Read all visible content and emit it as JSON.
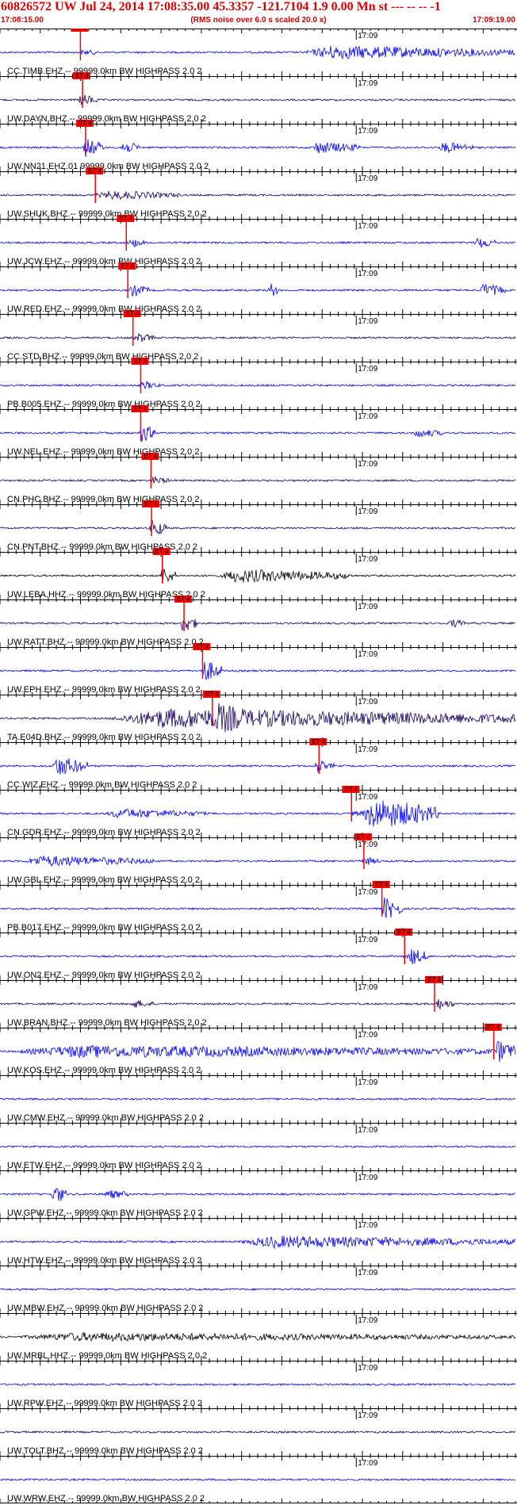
{
  "header": {
    "title": "60826572 UW Jul 24, 2014 17:08:35.00   45.3357 -121.7104  1.9 0.00 Mn st --- -- --   -1",
    "start_time": "17:08:15.00",
    "note": "(RMS noise over 6.0 s scaled 20.0 x)",
    "end_time": "17:09:19.00"
  },
  "colors": {
    "header_text": "#e00000",
    "pick": "#ff0000",
    "trace_blue": "#0000ff",
    "trace_navy": "#1a0060",
    "trace_black": "#000000"
  },
  "chart_data": {
    "type": "line",
    "title": "60826572 UW Jul 24, 2014 17:08:35.00   45.3357 -121.7104  1.9 0.00 Mn st --- -- --   -1",
    "x_range": [
      "17:08:15.00",
      "17:09:19.00"
    ],
    "mid_time_label": "17:09",
    "pick_label": "ET 4",
    "series": [
      {
        "label": "CC.TIMB.EHZ.--  99999.0km BW  HIGHPASS  2.0  2",
        "color": "#0000ff",
        "pick": 0.156,
        "bursts": [
          [
            0.58,
            1.0,
            2.2
          ]
        ]
      },
      {
        "label": "UW.DAYN.BHZ.--  99999.0km BW  HIGHPASS  2.0  2",
        "color": "#1a0060",
        "pick": 0.16,
        "bursts": [
          [
            0.15,
            0.19,
            2.0
          ]
        ]
      },
      {
        "label": "UW.NN21.EHZ.01  99999.0km BW  HIGHPASS  2.0  2",
        "color": "#0000ff",
        "pick": 0.166,
        "bursts": [
          [
            0.16,
            0.2,
            3.0
          ],
          [
            0.23,
            0.27,
            2.2
          ],
          [
            0.6,
            0.7,
            2.0
          ],
          [
            0.85,
            0.92,
            1.8
          ]
        ]
      },
      {
        "label": "UW.SHUK.BHZ.--  99999.0km BW  HIGHPASS  2.0  2",
        "color": "#1a0060",
        "pick": 0.185,
        "bursts": [
          [
            0.19,
            0.35,
            1.5
          ]
        ]
      },
      {
        "label": "UW.JCW.EHZ.--  99999.0km BW  HIGHPASS  2.0  2",
        "color": "#0000ff",
        "pick": 0.245,
        "bursts": [
          [
            0.25,
            0.28,
            1.6
          ],
          [
            0.92,
            0.96,
            2.0
          ]
        ]
      },
      {
        "label": "UW.RED.EHZ.--  99999.0km BW  HIGHPASS  2.0  2",
        "color": "#0000ff",
        "pick": 0.248,
        "bursts": [
          [
            0.25,
            0.29,
            2.0
          ],
          [
            0.52,
            0.54,
            2.6
          ],
          [
            0.93,
            0.98,
            2.2
          ]
        ]
      },
      {
        "label": "CC.STD.BHZ.--  99999.0km BW  HIGHPASS  2.0  2",
        "color": "#1a0060",
        "pick": 0.258,
        "bursts": [
          [
            0.26,
            0.3,
            1.6
          ]
        ]
      },
      {
        "label": "PB.B005.EHZ.--  99999.0km BW  HIGHPASS  2.0  2",
        "color": "#0000ff",
        "pick": 0.273,
        "bursts": [
          [
            0.27,
            0.31,
            1.4
          ]
        ]
      },
      {
        "label": "UW.NEL.EHZ.--  99999.0km BW  HIGHPASS  2.0  2",
        "color": "#0000ff",
        "pick": 0.273,
        "bursts": [
          [
            0.27,
            0.3,
            3.0
          ],
          [
            0.8,
            0.86,
            1.5
          ]
        ]
      },
      {
        "label": "CN.PHC.BHZ.--  99999.0km BW  HIGHPASS  2.0  2",
        "color": "#1a0060",
        "pick": 0.293,
        "bursts": [
          [
            0.29,
            0.33,
            1.4
          ]
        ]
      },
      {
        "label": "CN.PNT.BHZ.--  99999.0km BW  HIGHPASS  2.0  2",
        "color": "#1a0060",
        "pick": 0.294,
        "bursts": [
          [
            0.29,
            0.32,
            3.2
          ]
        ]
      },
      {
        "label": "UW.LEBA.HHZ.--  99999.0km BW  HIGHPASS  2.0  2",
        "color": "#000000",
        "pick": 0.315,
        "bursts": [
          [
            0.31,
            0.34,
            3.0
          ],
          [
            0.42,
            0.68,
            2.2
          ]
        ]
      },
      {
        "label": "UW.RATT.BHZ.--  99999.0km BW  HIGHPASS  2.0  2",
        "color": "#1a0060",
        "pick": 0.357,
        "bursts": [
          [
            0.35,
            0.38,
            3.2
          ],
          [
            0.87,
            0.9,
            1.6
          ]
        ]
      },
      {
        "label": "UW.EPH.EHZ.--  99999.0km BW  HIGHPASS  2.0  2",
        "color": "#0000ff",
        "pick": 0.393,
        "bursts": [
          [
            0.39,
            0.43,
            3.6
          ]
        ]
      },
      {
        "label": "TA.E04D.BHZ.--  99999.0km BW  HIGHPASS  2.0  2",
        "color": "#1a0060",
        "pick": 0.412,
        "bursts": [
          [
            0.2,
            1.0,
            3.2
          ],
          [
            0.41,
            0.5,
            5.0
          ]
        ]
      },
      {
        "label": "CC.WIZ.EHZ.--  99999.0km BW  HIGHPASS  2.0  2",
        "color": "#0000ff",
        "pick": 0.619,
        "bursts": [
          [
            0.1,
            0.17,
            3.2
          ],
          [
            0.61,
            0.63,
            2.6
          ]
        ]
      },
      {
        "label": "CN.GDR.EHZ.--  99999.0km BW  HIGHPASS  2.0  2",
        "color": "#0000ff",
        "pick": 0.682,
        "bursts": [
          [
            0.7,
            0.85,
            5.0
          ],
          [
            0.2,
            0.4,
            1.6
          ]
        ]
      },
      {
        "label": "UW.GBL.EHZ.--  99999.0km BW  HIGHPASS  2.0  2",
        "color": "#0000ff",
        "pick": 0.706,
        "bursts": [
          [
            0.04,
            0.3,
            1.8
          ],
          [
            0.7,
            0.73,
            1.6
          ]
        ]
      },
      {
        "label": "PB.B017.EHZ.--  99999.0km BW  HIGHPASS  2.0  2",
        "color": "#0000ff",
        "pick": 0.741,
        "bursts": [
          [
            0.74,
            0.78,
            3.6
          ]
        ]
      },
      {
        "label": "UW.ON2.EHZ.--  99999.0km BW  HIGHPASS  2.0  2",
        "color": "#0000ff",
        "pick": 0.785,
        "bursts": [
          [
            0.79,
            0.83,
            2.8
          ]
        ]
      },
      {
        "label": "UW.BRAN.BHZ.--  99999.0km BW  HIGHPASS  2.0  2",
        "color": "#1a0060",
        "pick": 0.843,
        "bursts": [
          [
            0.84,
            0.88,
            2.0
          ],
          [
            0.25,
            0.3,
            1.4
          ]
        ]
      },
      {
        "label": "UW.KOS.EHZ.--  99999.0km BW  HIGHPASS  2.0  2",
        "color": "#0000ff",
        "pick": 0.958,
        "bursts": [
          [
            0.0,
            1.0,
            2.0
          ],
          [
            0.96,
            1.0,
            3.8
          ]
        ]
      },
      {
        "label": "UW.CMW.EHZ.--  99999.0km BW  HIGHPASS  2.0  2",
        "color": "#0000ff",
        "pick": null,
        "bursts": []
      },
      {
        "label": "UW.ETW.EHZ.--  99999.0km BW  HIGHPASS  2.0  2",
        "color": "#0000ff",
        "pick": null,
        "bursts": []
      },
      {
        "label": "UW.GPW.EHZ.--  99999.0km BW  HIGHPASS  2.0  2",
        "color": "#0000ff",
        "pick": null,
        "bursts": [
          [
            0.1,
            0.13,
            3.2
          ],
          [
            0.2,
            0.25,
            1.6
          ]
        ]
      },
      {
        "label": "UW.HTW.EHZ.--  99999.0km BW  HIGHPASS  2.0  2",
        "color": "#0000ff",
        "pick": null,
        "bursts": [
          [
            0.45,
            1.0,
            2.0
          ]
        ]
      },
      {
        "label": "UW.MBW.EHZ.--  99999.0km BW  HIGHPASS  2.0  2",
        "color": "#0000ff",
        "pick": null,
        "bursts": []
      },
      {
        "label": "UW.MRBL.HHZ.--  99999.0km BW  HIGHPASS  2.0  2",
        "color": "#000000",
        "pick": null,
        "bursts": [
          [
            0.0,
            1.0,
            1.4
          ]
        ]
      },
      {
        "label": "UW.RPW.EHZ.--  99999.0km BW  HIGHPASS  2.0  2",
        "color": "#0000ff",
        "pick": null,
        "bursts": []
      },
      {
        "label": "UW.TOLT.BHZ.--  99999.0km BW  HIGHPASS  2.0  2",
        "color": "#1a0060",
        "pick": null,
        "bursts": []
      },
      {
        "label": "UW.WRW.EHZ.--  99999.0km BW  HIGHPASS  2.0  2",
        "color": "#0000ff",
        "pick": null,
        "bursts": []
      }
    ]
  }
}
